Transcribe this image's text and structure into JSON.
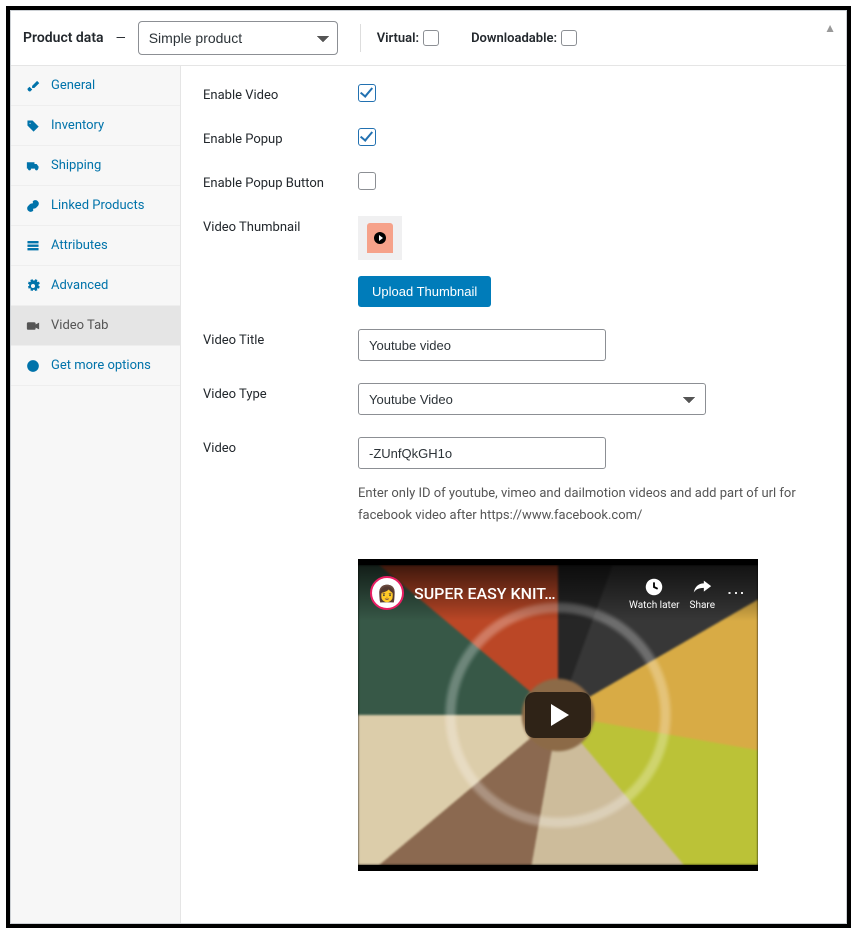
{
  "header": {
    "title": "Product data",
    "product_type_options": [
      "Simple product"
    ],
    "product_type_selected": "Simple product",
    "virtual_label": "Virtual:",
    "virtual_checked": false,
    "downloadable_label": "Downloadable:",
    "downloadable_checked": false
  },
  "tabs": [
    {
      "key": "general",
      "label": "General",
      "icon": "wrench-icon"
    },
    {
      "key": "inventory",
      "label": "Inventory",
      "icon": "tag-icon"
    },
    {
      "key": "shipping",
      "label": "Shipping",
      "icon": "truck-icon"
    },
    {
      "key": "linked",
      "label": "Linked Products",
      "icon": "link-icon"
    },
    {
      "key": "attributes",
      "label": "Attributes",
      "icon": "list-icon"
    },
    {
      "key": "advanced",
      "label": "Advanced",
      "icon": "gear-icon"
    },
    {
      "key": "video",
      "label": "Video Tab",
      "icon": "camera-icon",
      "active": true
    },
    {
      "key": "more",
      "label": "Get more options",
      "icon": "plus-icon"
    }
  ],
  "form": {
    "enable_video": {
      "label": "Enable Video",
      "checked": true
    },
    "enable_popup": {
      "label": "Enable Popup",
      "checked": true
    },
    "enable_popup_button": {
      "label": "Enable Popup Button",
      "checked": false
    },
    "video_thumbnail": {
      "label": "Video Thumbnail",
      "upload_btn": "Upload Thumbnail"
    },
    "video_title": {
      "label": "Video Title",
      "value": "Youtube video"
    },
    "video_type": {
      "label": "Video Type",
      "options": [
        "Youtube Video"
      ],
      "selected": "Youtube Video"
    },
    "video": {
      "label": "Video",
      "value": "-ZUnfQkGH1o",
      "help": "Enter only ID of youtube, vimeo and dailmotion videos and add part of url for facebook video after https://www.facebook.com/"
    }
  },
  "preview": {
    "title": "SUPER EASY KNIT…",
    "watch_later": "Watch later",
    "share": "Share"
  }
}
